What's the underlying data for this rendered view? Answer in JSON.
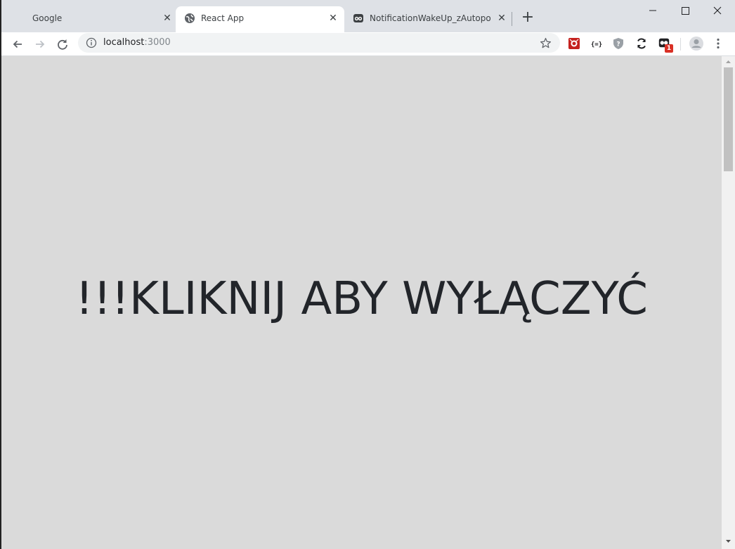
{
  "tabs": [
    {
      "title": "Google",
      "favicon": "google-icon",
      "active": false
    },
    {
      "title": "React App",
      "favicon": "globe-icon",
      "active": true
    },
    {
      "title": "NotificationWakeUp_zAutopobie",
      "favicon": "robot-icon",
      "active": false
    }
  ],
  "newtab_label": "+",
  "toolbar": {
    "url_host": "localhost",
    "url_port": ":3000"
  },
  "extensions": [
    {
      "name": "red-extension-icon"
    },
    {
      "name": "json-formatter-icon"
    },
    {
      "name": "shield-question-icon"
    },
    {
      "name": "sync-icon"
    },
    {
      "name": "notification-extension-icon",
      "badge": "1"
    }
  ],
  "content": {
    "headline": "!!!KLIKNIJ ABY WYŁĄCZYĆ"
  },
  "colors": {
    "page_bg": "#dadada",
    "headline": "#22252a",
    "badge": "#d93025"
  }
}
